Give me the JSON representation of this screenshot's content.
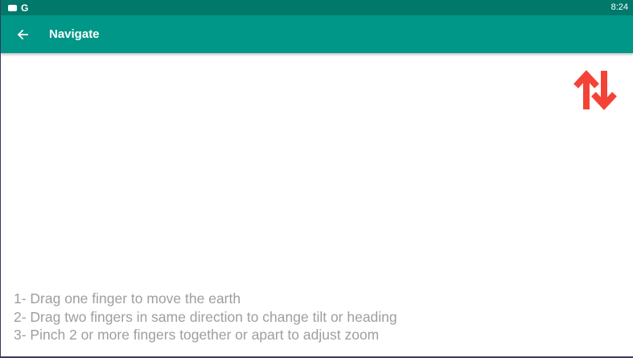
{
  "status_bar": {
    "time": "8:24",
    "left_icons": [
      "notification-icon",
      "google-icon"
    ],
    "google_glyph": "G"
  },
  "app_bar": {
    "title": "Navigate",
    "back_icon": "arrow-left-icon",
    "color": "#009688",
    "status_color": "#00796b"
  },
  "actions": {
    "swap_icon": "swap-vertical-icon",
    "swap_color": "#f44336"
  },
  "instructions": [
    "1- Drag one finger to move the earth",
    "2- Drag two fingers in same direction to change tilt or heading",
    "3- Pinch 2 or more fingers together or apart to adjust zoom"
  ]
}
